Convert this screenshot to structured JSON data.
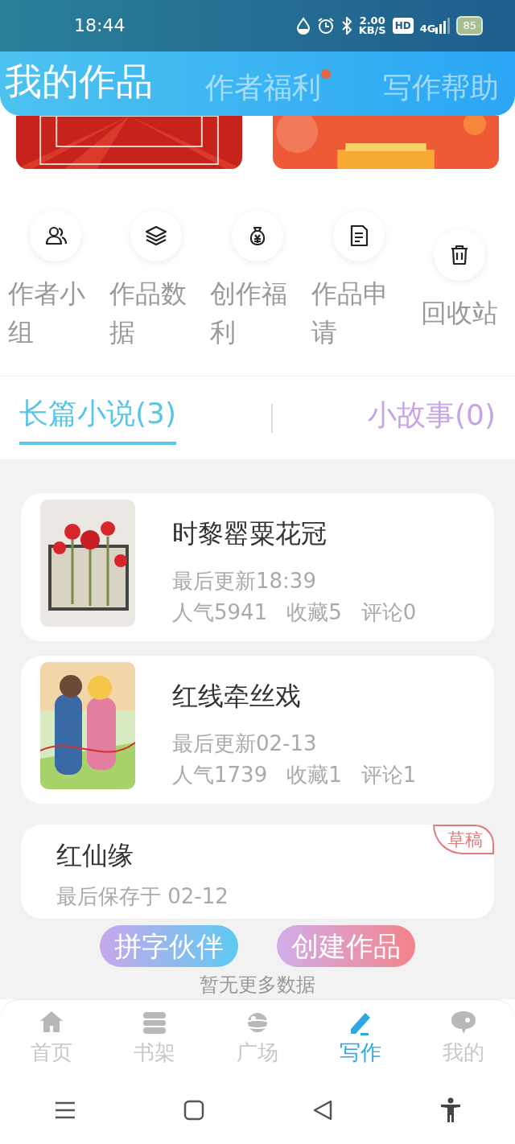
{
  "status_bar": {
    "time": "18:44",
    "net_speed": "2.00",
    "net_speed_unit": "KB/S",
    "hd": "HD",
    "network": "4G",
    "battery": "85"
  },
  "header_tabs": [
    {
      "label": "我的作品",
      "selected": true,
      "dot": false
    },
    {
      "label": "作者福利",
      "selected": false,
      "dot": true
    },
    {
      "label": "写作帮助",
      "selected": false,
      "dot": false
    }
  ],
  "banners": [
    {
      "kind": "picture"
    },
    {
      "kind": "picture"
    }
  ],
  "shortcuts": [
    {
      "kind": "group",
      "label": "作者小组"
    },
    {
      "kind": "layers",
      "label": "作品数据"
    },
    {
      "kind": "money",
      "label": "创作福利"
    },
    {
      "kind": "document",
      "label": "作品申请"
    },
    {
      "kind": "trash",
      "label": "回收站"
    }
  ],
  "work_tabs": [
    {
      "label": "长篇小说(3)",
      "selected": true
    },
    {
      "label": "小故事(0)",
      "selected": false
    }
  ],
  "works": [
    {
      "kind": "published",
      "title": "时黎罂粟花冠",
      "updated": "最后更新18:39",
      "stats": [
        "人气5941",
        "收藏5",
        "评论0"
      ]
    },
    {
      "kind": "published",
      "title": "红线牵丝戏",
      "updated": "最后更新02-13",
      "stats": [
        "人气1739",
        "收藏1",
        "评论1"
      ]
    },
    {
      "kind": "draft",
      "title": "红仙缘",
      "updated": "最后保存于 02-12",
      "badge": "草稿"
    }
  ],
  "action_buttons": [
    "拼字伙伴",
    "创建作品"
  ],
  "footer_note": "暂无更多数据",
  "bottom_nav": [
    {
      "kind": "home",
      "label": "首页",
      "selected": false
    },
    {
      "kind": "shelf",
      "label": "书架",
      "selected": false
    },
    {
      "kind": "planet",
      "label": "广场",
      "selected": false
    },
    {
      "kind": "pencil",
      "label": "写作",
      "selected": true
    },
    {
      "kind": "chat",
      "label": "我的",
      "selected": false
    }
  ]
}
